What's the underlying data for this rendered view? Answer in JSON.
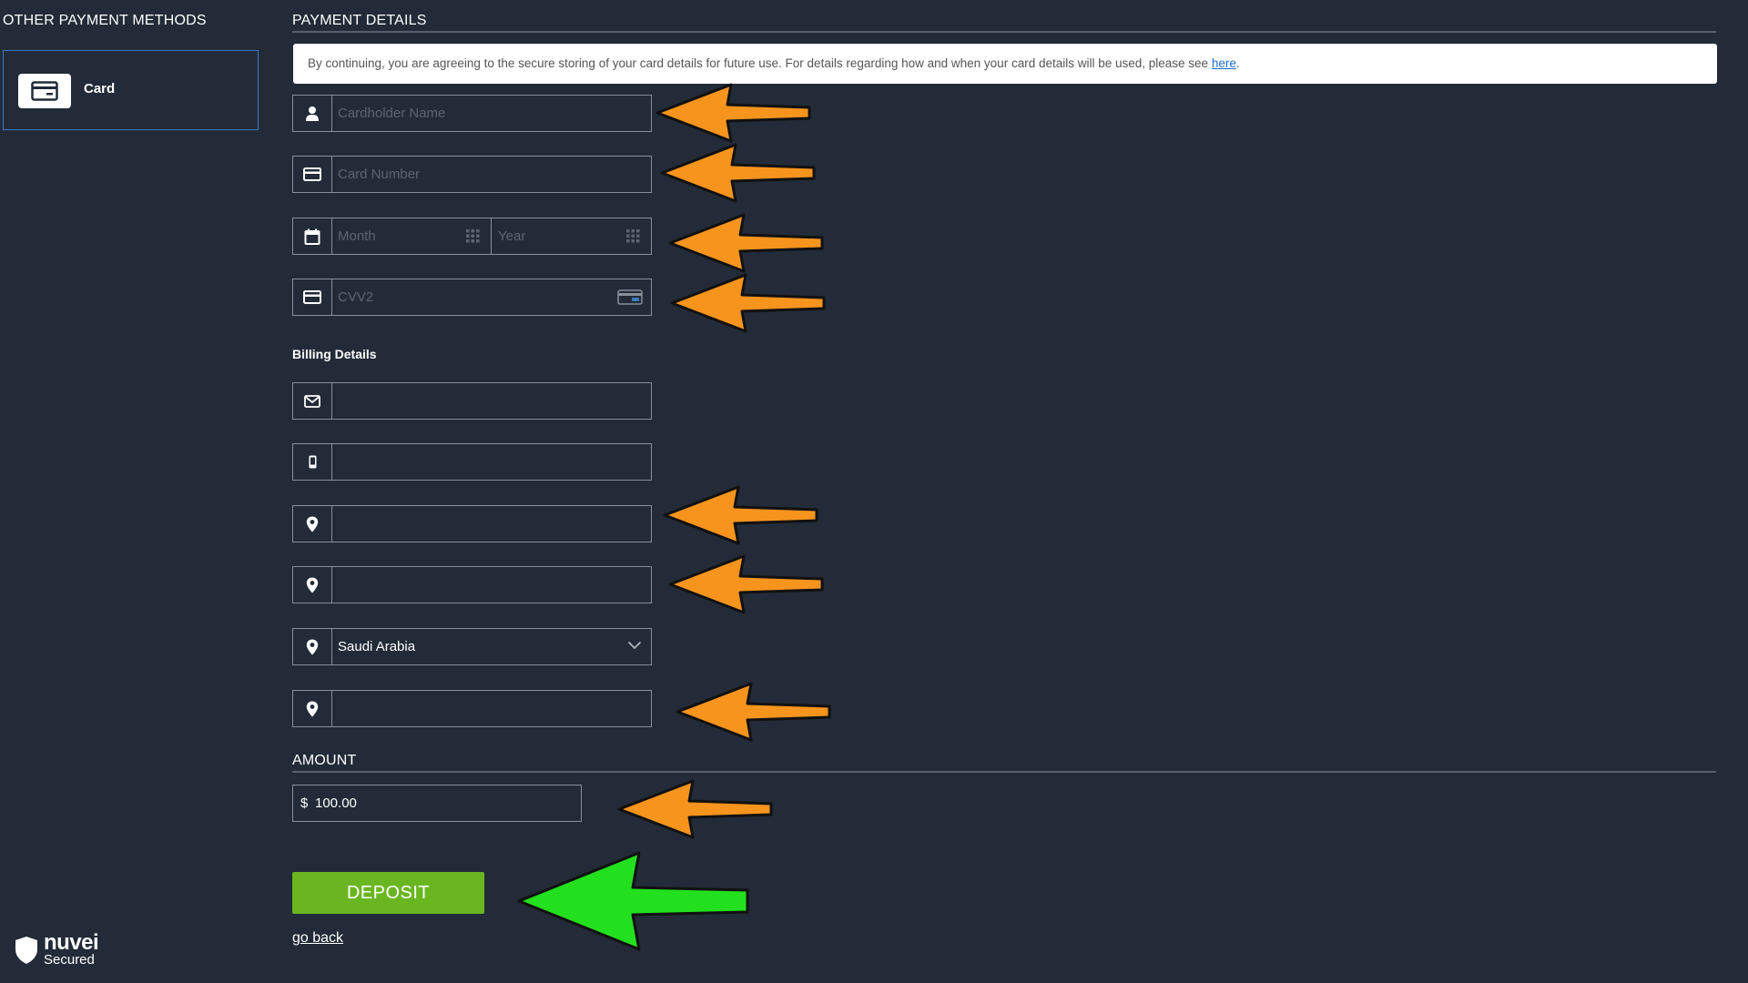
{
  "sidebar": {
    "title": "OTHER PAYMENT METHODS",
    "methods": [
      {
        "label": "Card",
        "icon": "credit-card-icon",
        "selected": true
      }
    ],
    "brand": {
      "name": "nuvei",
      "subtitle": "Secured"
    }
  },
  "payment": {
    "title": "PAYMENT DETAILS",
    "notice_text": "By continuing, you are agreeing to the secure storing of your card details for future use. For details regarding how and when your card details will be used, please see ",
    "notice_link": "here",
    "notice_end": ".",
    "fields": {
      "cardholder_placeholder": "Cardholder Name",
      "card_number_placeholder": "Card Number",
      "month_placeholder": "Month",
      "year_placeholder": "Year",
      "cvv_placeholder": "CVV2"
    }
  },
  "billing": {
    "label": "Billing Details",
    "email_value": "",
    "phone_value": "",
    "address_value": "",
    "city_value": "",
    "country_value": "Saudi Arabia",
    "zip_value": ""
  },
  "amount": {
    "title": "AMOUNT",
    "currency_symbol": "$",
    "value": "100.00"
  },
  "actions": {
    "deposit_label": "DEPOSIT",
    "go_back_label": "go back"
  },
  "colors": {
    "background": "#222b37",
    "deposit_button": "#6ab621",
    "annotation_arrow_orange": "#f7941d",
    "annotation_arrow_green": "#22e01e",
    "selected_border": "#3b79c4"
  }
}
